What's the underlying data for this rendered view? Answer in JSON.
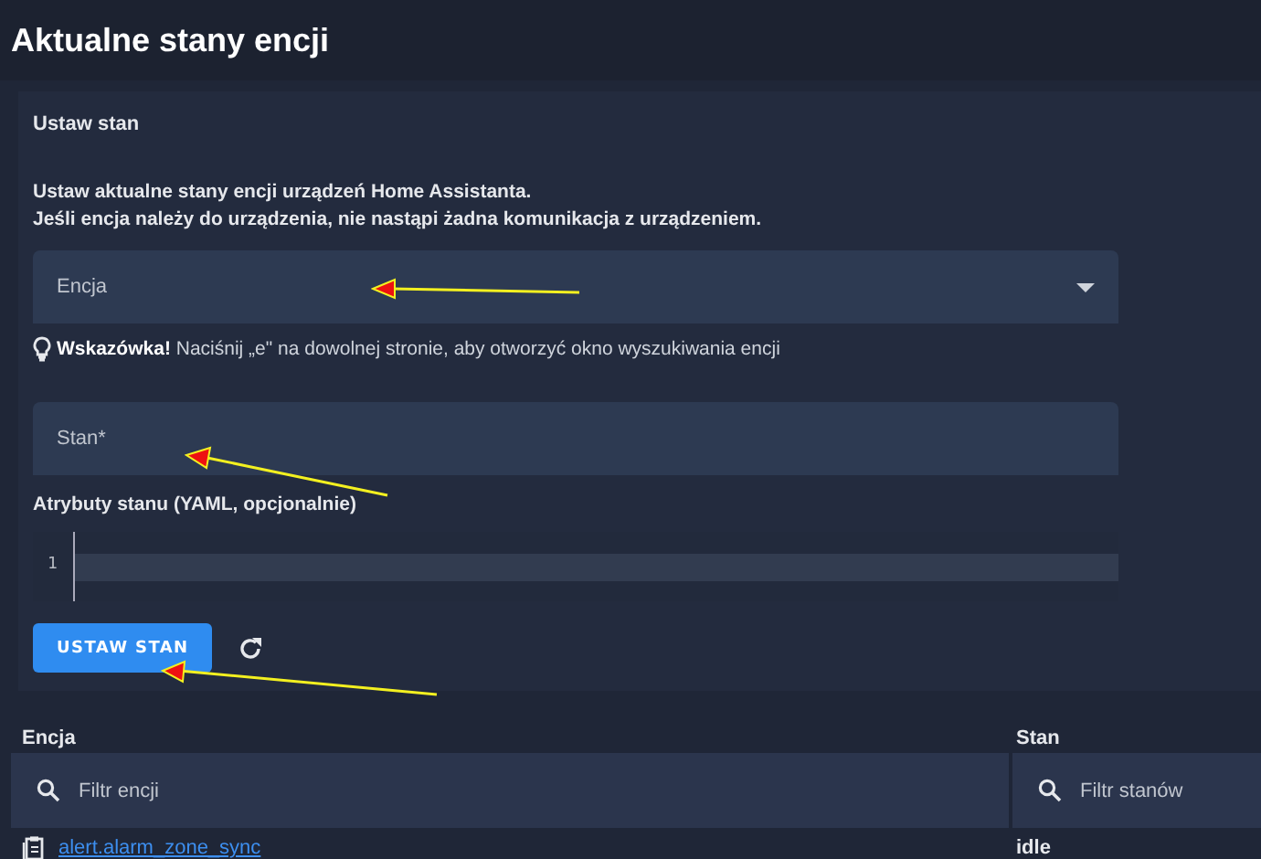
{
  "page_title": "Aktualne stany encji",
  "card": {
    "title": "Ustaw stan",
    "description_lines": [
      "Ustaw aktualne stany encji urządzeń Home Assistanta.",
      "Jeśli encja należy do urządzenia, nie nastąpi żadna komunikacja z urządzeniem."
    ],
    "entity_field": {
      "label": "Encja"
    },
    "hint": "**Wskazówka!** Naciśnij „e\" na dowolnej stronie, aby otworzyć okno wyszukiwania encji",
    "state_field": {
      "label": "Stan*"
    },
    "attributes_label": "Atrybuty stanu (YAML, opcjonalnie)",
    "editor": {
      "line_numbers": [
        "1"
      ]
    },
    "button": "USTAW STAN"
  },
  "table": {
    "columns": [
      {
        "title": "Encja",
        "filter_placeholder": "Filtr encji"
      },
      {
        "title": "Stan",
        "filter_placeholder": "Filtr stanów"
      }
    ],
    "rows": [
      {
        "entity": "alert.alarm_zone_sync",
        "state": "idle"
      }
    ]
  }
}
